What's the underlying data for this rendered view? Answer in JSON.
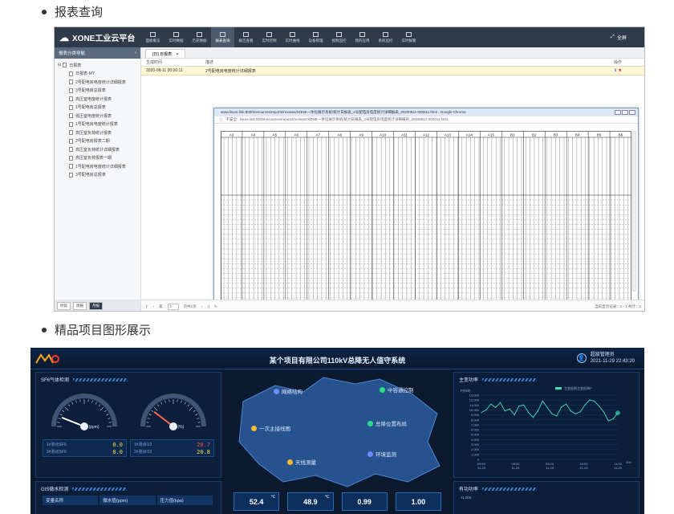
{
  "section1": {
    "bullet": "报表查询"
  },
  "app1": {
    "brand": "XONE工业云平台",
    "menu": [
      {
        "label": "面板概览"
      },
      {
        "label": "实时数据"
      },
      {
        "label": "历史数据"
      },
      {
        "label": "报表查询",
        "active": true
      },
      {
        "label": "报告查看"
      },
      {
        "label": "实时控制"
      },
      {
        "label": "实时曲线"
      },
      {
        "label": "设备管理"
      },
      {
        "label": "视频监控"
      },
      {
        "label": "我的应用"
      },
      {
        "label": "系统监控"
      },
      {
        "label": "实时报警"
      }
    ],
    "fullscreen": "全屏",
    "sidebar": {
      "header": "报表分类导航",
      "root": "日报表",
      "items": [
        "日报表-MY",
        "2号配电房电度统计详细报表",
        "3号配电房总报表",
        "高压室电度统计报表",
        "1号配电房总报表",
        "低压室电度统计报表",
        "1号配电房电度统计报表",
        "高压室负荷统计报表",
        "2号配电房报表二期",
        "高压室负荷统计详细报表",
        "高压室负荷报表一期",
        "1号配电房电度统计详细报表",
        "3号配电房总报表"
      ],
      "footer_tabs": [
        "时段",
        "周报",
        "月报"
      ]
    },
    "tab": "[日] 日报表",
    "table": {
      "headers": [
        "生成时间",
        "描述",
        "操作"
      ],
      "row": [
        "2020-08-11 00:00:11",
        "2号配电房电度统计详细报表",
        ""
      ]
    },
    "pager": {
      "page_label": "第",
      "page_value": "1",
      "page_total": "页共1页",
      "summary": "当前显示记录：1 - 1 共计：1"
    },
    "popup": {
      "title": "www.lisure.link:8000/resources/reports/reviews/XONE一体化展示系统/统计日报表_2号配电房电度统计详细报表_20200811-000011.html - Google Chrome",
      "security": "不安全",
      "url": "lisure.link:8000/resources/reports/reviews/XONE一体化展示系统/统计日报表_2号配电房电度统计详细报表_20200811-000011.html"
    },
    "report": {
      "groups": [
        "A3",
        "A4",
        "A5",
        "A6",
        "A7",
        "A8",
        "A9",
        "A10",
        "A11",
        "A12",
        "A13",
        "A14",
        "A15",
        "B1",
        "B2",
        "B3",
        "B4",
        "B5",
        "B6"
      ]
    }
  },
  "section2": {
    "bullet": "精品项目图形展示"
  },
  "app2": {
    "title": "某个项目有限公司110kV总降无人值守系统",
    "user": {
      "name": "超级管理员",
      "time": "2021-11-29 22:43:20"
    },
    "sf6": {
      "title": "SF6气体检测",
      "gauge1_unit": "(ppm)",
      "gauge2_unit": "(%)",
      "gauge1_value": 12,
      "gauge2_value": 20.8,
      "stats": [
        {
          "l1": "1#测点SF6",
          "v1": "0.0",
          "l2": "2#测点SF6",
          "v2": "0.0"
        },
        {
          "l1": "1#测点O2",
          "v1": "20.7",
          "l2": "2#测点O2",
          "v2": "20.8"
        }
      ]
    },
    "map": {
      "labels": [
        "网络结构",
        "中容通控制",
        "一次主接线图",
        "总降位置布局",
        "天线测量",
        "环境监测"
      ],
      "colors": [
        "#6b8cff",
        "#2ddc8a",
        "#f5b933",
        "#2ddc8a",
        "#f5b933",
        "#6b8cff"
      ]
    },
    "kpis": [
      {
        "value": "52.4",
        "unit": "℃"
      },
      {
        "value": "48.9",
        "unit": "℃"
      },
      {
        "value": "0.99",
        "unit": ""
      },
      {
        "value": "1.00",
        "unit": ""
      }
    ],
    "power": {
      "title": "主变功率",
      "ylabel": "P(kW)",
      "legend": "主变低侧主变低侧P",
      "yticks": [
        "13,000",
        "12,000",
        "11,000",
        "10,000",
        "9,000",
        "8,000",
        "7,000",
        "6,000",
        "5,000",
        "4,000",
        "3,000",
        "2,000",
        "1,000",
        "0"
      ],
      "xticks": [
        "09:00\n11-29",
        "09:00\n11-29",
        "09:00\n11-29",
        "10:00\n11-29",
        "11:00\n11-29"
      ],
      "xmax_label": "100"
    },
    "gis": {
      "title": "GIS微水检测",
      "headers": [
        "变量名称",
        "微水值(ppm)",
        "压力值(kpa)"
      ]
    },
    "active": {
      "title": "有功功率",
      "ytick": "11,000"
    }
  },
  "chart_data": {
    "type": "line",
    "ylabel": "P(kW)",
    "ylim": [
      0,
      13000
    ],
    "series": [
      {
        "name": "主变低侧主变低侧P",
        "values": [
          9500,
          10000,
          11200,
          10500,
          11500,
          9800,
          10200,
          9000,
          10800,
          11000,
          9500,
          8500,
          9800,
          11800,
          10500,
          9200,
          8800,
          10600,
          11200,
          9800,
          9200,
          9600,
          11000,
          12000,
          11800,
          10800,
          9600,
          7800,
          8200,
          9400
        ]
      }
    ]
  }
}
